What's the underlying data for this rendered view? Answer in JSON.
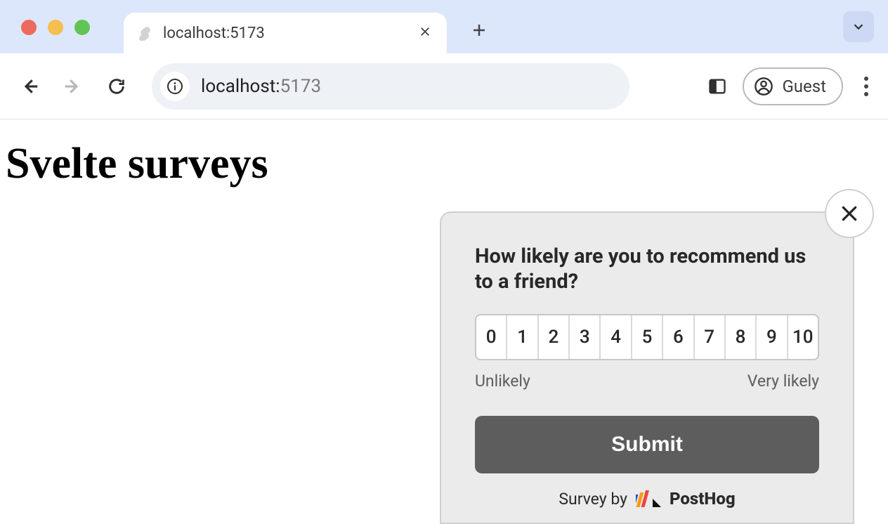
{
  "browser": {
    "tab_title": "localhost:5173",
    "address_host": "localhost:",
    "address_port": "5173",
    "guest_label": "Guest"
  },
  "page": {
    "heading": "Svelte surveys"
  },
  "survey": {
    "question": "How likely are you to recommend us to a friend?",
    "ratings": [
      "0",
      "1",
      "2",
      "3",
      "4",
      "5",
      "6",
      "7",
      "8",
      "9",
      "10"
    ],
    "low_label": "Unlikely",
    "high_label": "Very likely",
    "submit_label": "Submit",
    "footer_prefix": "Survey by",
    "brand_name": "PostHog"
  }
}
